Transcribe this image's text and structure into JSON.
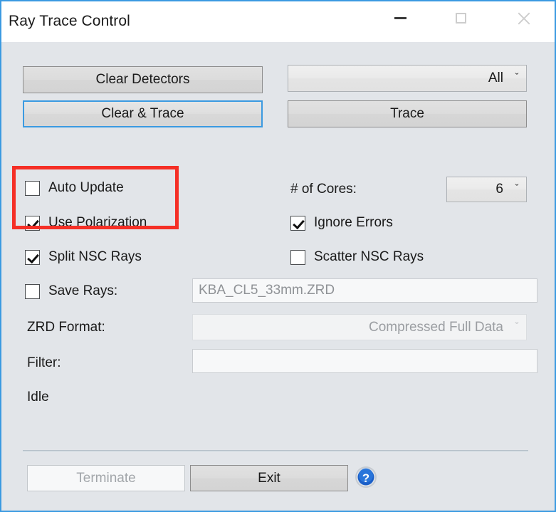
{
  "window": {
    "title": "Ray Trace Control",
    "controls": {
      "minimize": "minimize-icon",
      "maximize": "maximize-icon",
      "close": "close-icon"
    },
    "border_color": "#3b9ae1",
    "background_color": "#e2e5e9"
  },
  "buttons": {
    "clear_detectors": "Clear Detectors",
    "clear_and_trace": "Clear & Trace",
    "trace": "Trace",
    "terminate": "Terminate",
    "exit": "Exit"
  },
  "dropdowns": {
    "scope": {
      "value": "All",
      "chevron": "ˇ"
    },
    "cores": {
      "label": "# of Cores:",
      "value": "6",
      "chevron": "ˇ"
    },
    "zrd_format": {
      "label": "ZRD Format:",
      "value": "Compressed Full Data",
      "chevron": "ˇ"
    }
  },
  "checkboxes": {
    "auto_update": {
      "label": "Auto Update",
      "checked": false
    },
    "use_polarization": {
      "label": "Use Polarization",
      "checked": true
    },
    "split_nsc_rays": {
      "label": "Split NSC Rays",
      "checked": true
    },
    "ignore_errors": {
      "label": "Ignore Errors",
      "checked": true
    },
    "scatter_nsc_rays": {
      "label": "Scatter NSC Rays",
      "checked": false
    },
    "save_rays": {
      "label": "Save Rays:",
      "checked": false
    }
  },
  "fields": {
    "save_rays_file": {
      "value": "KBA_CL5_33mm.ZRD",
      "placeholder": ""
    },
    "filter": {
      "value": "",
      "placeholder": ""
    },
    "filter_label": "Filter:"
  },
  "status": {
    "text": "Idle"
  },
  "help": {
    "icon": "help-question-icon",
    "color": "#1b5fc8"
  },
  "annotation": {
    "color": "#f52f26",
    "targets": "Use Polarization, Split NSC Rays"
  }
}
